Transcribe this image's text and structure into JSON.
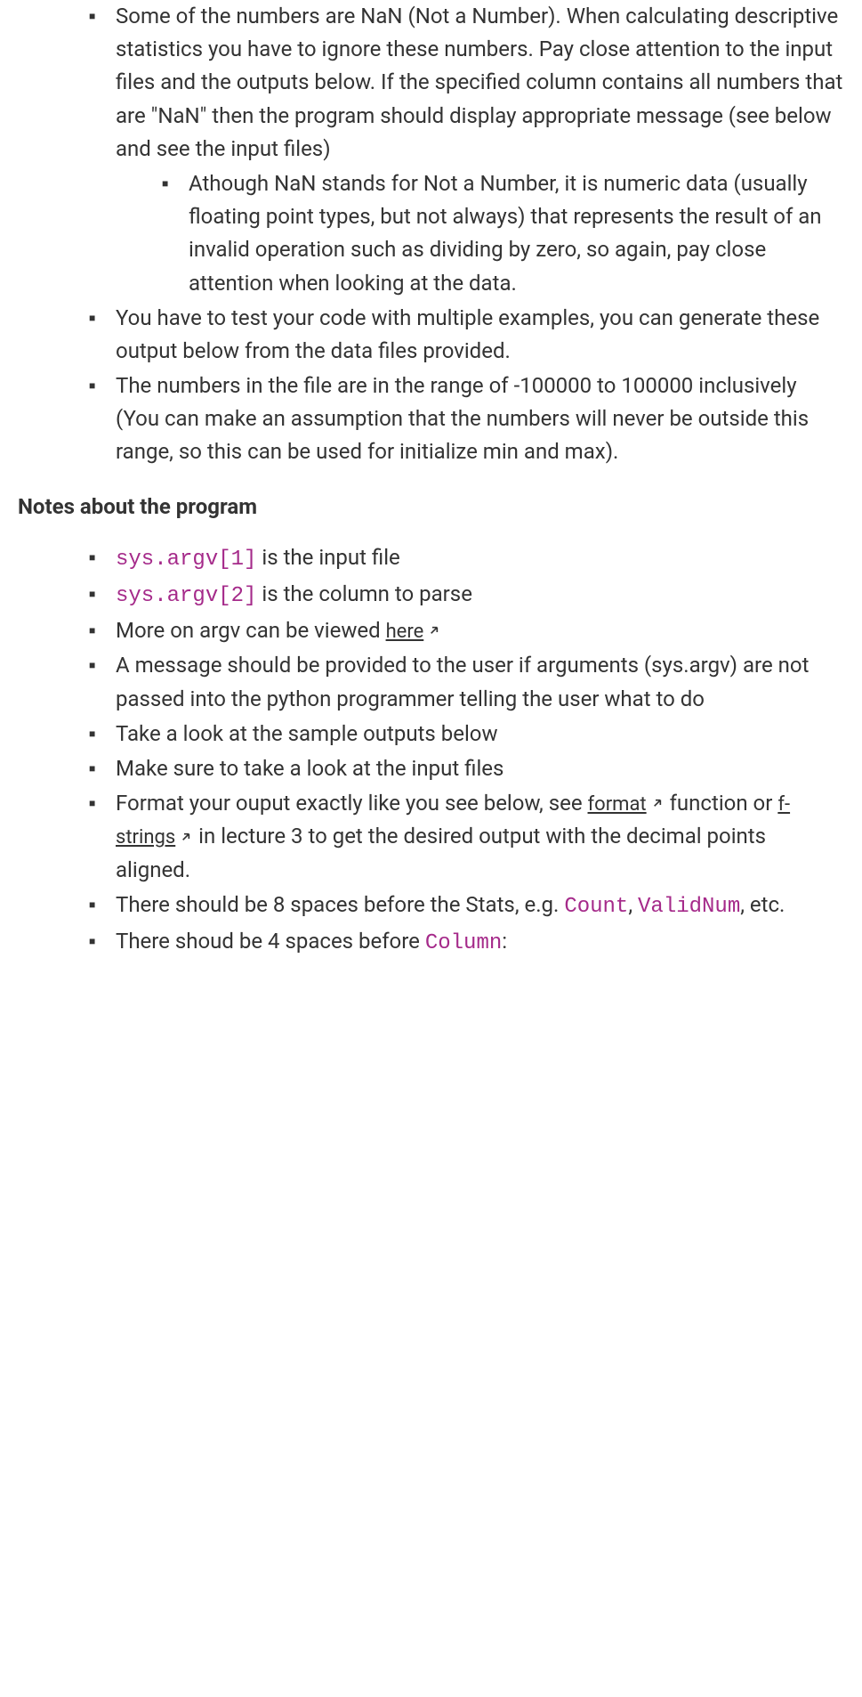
{
  "section1": {
    "items": [
      {
        "text": "Some of the numbers are NaN (Not a Number). When calculating descriptive statistics you have to ignore these numbers. Pay close attention to the input files and the outputs below. If the specified column contains all numbers that are \"NaN\" then the program should display appropriate message (see below and see the input files)",
        "nested": [
          "Athough NaN stands for Not a Number, it is numeric data (usually floating point types, but not always) that represents the result of an invalid operation such as dividing by zero, so again, pay close attention when looking at the data."
        ]
      },
      {
        "text": "You have to test your code with multiple examples, you can generate these output below from the data files provided."
      },
      {
        "text": "The numbers in the file are in the range of -100000 to 100000 inclusively (You can make an assumption that the numbers will never be outside this range, so this can be used for initialize min and max)."
      }
    ]
  },
  "heading": "Notes about the program",
  "section2": {
    "items": {
      "argv1_code": "sys.argv[1]",
      "argv1_rest": " is the input file",
      "argv2_code": "sys.argv[2]",
      "argv2_rest": " is the column to parse",
      "more_argv_pre": "More on argv can be viewed ",
      "more_argv_link": "here",
      "msg": "A message should be provided to the user if arguments (sys.argv) are not passed into the python programmer telling the user what to do",
      "look_sample": "Take a look at the sample outputs below",
      "look_input": "Make sure to take a look at the input files",
      "format_pre": "Format your ouput exactly like you see below, see ",
      "format_link": "format",
      "format_mid": " function or ",
      "fstrings_link": "f-strings",
      "format_post": " in lecture 3 to get the desired output with the decimal points aligned.",
      "spaces8_pre": "There should be 8 spaces before the Stats, e.g. ",
      "count_code": "Count",
      "comma_sp": ", ",
      "validnum_code": "ValidNum",
      "spaces8_post": ", etc.",
      "spaces4_pre": "There shoud be 4 spaces before ",
      "column_code": "Column",
      "colon": ":"
    }
  }
}
